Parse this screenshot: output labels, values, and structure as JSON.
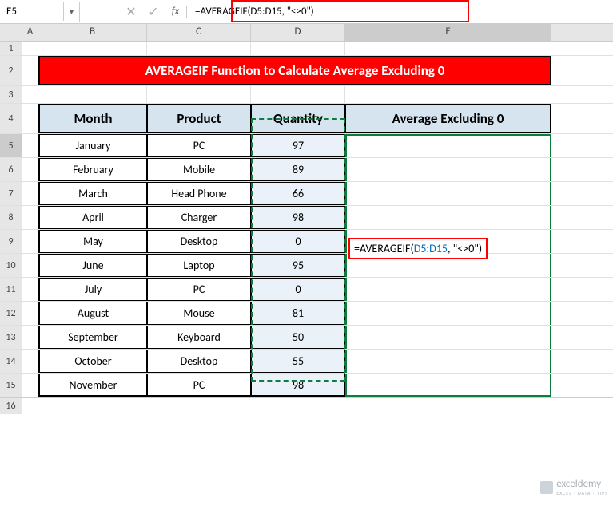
{
  "namebox": "E5",
  "formula_bar": "=AVERAGEIF(D5:D15, \"<>0\")",
  "formula_overlay_prefix": "=AVERAGEIF(",
  "formula_overlay_range": "D5:D15",
  "formula_overlay_suffix": ", \"<>0\")",
  "columns": {
    "A": "A",
    "B": "B",
    "C": "C",
    "D": "D",
    "E": "E"
  },
  "rows": [
    "1",
    "2",
    "3",
    "4",
    "5",
    "6",
    "7",
    "8",
    "9",
    "10",
    "11",
    "12",
    "13",
    "14",
    "15",
    "16"
  ],
  "title": "AVERAGEIF Function to Calculate Average Excluding 0",
  "headers": {
    "month": "Month",
    "product": "Product",
    "quantity": "Quantity",
    "average": "Average Excluding 0"
  },
  "data": [
    {
      "month": "January",
      "product": "PC",
      "quantity": 97
    },
    {
      "month": "February",
      "product": "Mobile",
      "quantity": 89
    },
    {
      "month": "March",
      "product": "Head Phone",
      "quantity": 66
    },
    {
      "month": "April",
      "product": "Charger",
      "quantity": 98
    },
    {
      "month": "May",
      "product": "Desktop",
      "quantity": 0
    },
    {
      "month": "June",
      "product": "Laptop",
      "quantity": 95
    },
    {
      "month": "July",
      "product": "PC",
      "quantity": 0
    },
    {
      "month": "August",
      "product": "Mouse",
      "quantity": 81
    },
    {
      "month": "September",
      "product": "Keyboard",
      "quantity": 50
    },
    {
      "month": "October",
      "product": "Desktop",
      "quantity": 55
    },
    {
      "month": "November",
      "product": "PC",
      "quantity": 98
    }
  ],
  "watermark": "exceldemy",
  "watermark_sub": "EXCEL · DATA · TIPS"
}
